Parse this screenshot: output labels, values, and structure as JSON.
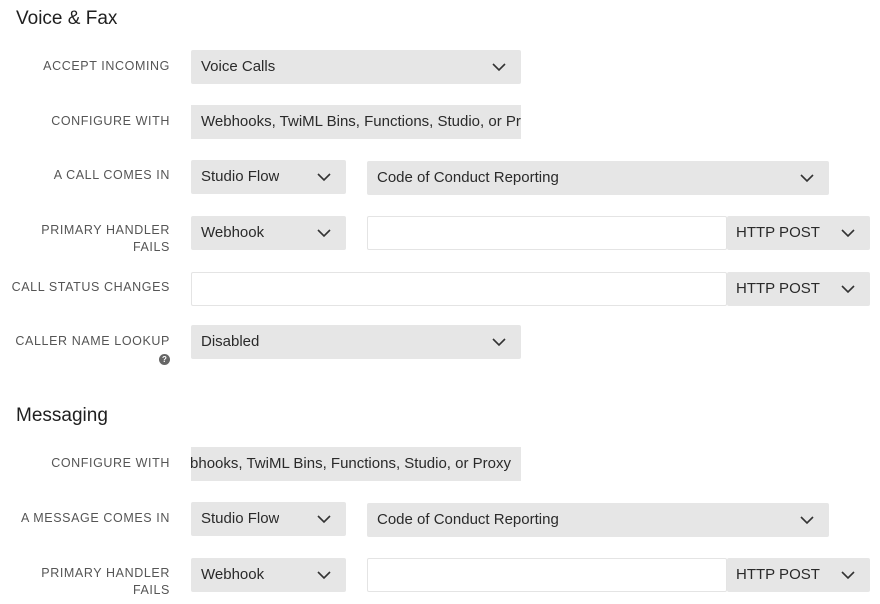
{
  "voice": {
    "title": "Voice & Fax",
    "accept_incoming": {
      "label": "ACCEPT INCOMING",
      "value": "Voice Calls"
    },
    "configure_with": {
      "label": "CONFIGURE WITH",
      "value": "Webhooks, TwiML Bins, Functions, Studio, or Proxy"
    },
    "call_comes_in": {
      "label": "A CALL COMES IN",
      "type": "Studio Flow",
      "flow": "Code of Conduct Reporting"
    },
    "primary_handler_fails": {
      "label_line1": "PRIMARY HANDLER",
      "label_line2": "FAILS",
      "type": "Webhook",
      "url": "",
      "method": "HTTP POST"
    },
    "call_status_changes": {
      "label": "CALL STATUS CHANGES",
      "url": "",
      "method": "HTTP POST"
    },
    "caller_name_lookup": {
      "label": "CALLER NAME LOOKUP",
      "help_icon": "?",
      "value": "Disabled"
    }
  },
  "messaging": {
    "title": "Messaging",
    "configure_with": {
      "label": "CONFIGURE WITH",
      "value": "Webhooks, TwiML Bins, Functions, Studio, or Proxy"
    },
    "message_comes_in": {
      "label": "A MESSAGE COMES IN",
      "type": "Studio Flow",
      "flow": "Code of Conduct Reporting"
    },
    "primary_handler_fails": {
      "label_line1": "PRIMARY HANDLER",
      "label_line2": "FAILS",
      "type": "Webhook",
      "url": "",
      "method": "HTTP POST"
    }
  }
}
